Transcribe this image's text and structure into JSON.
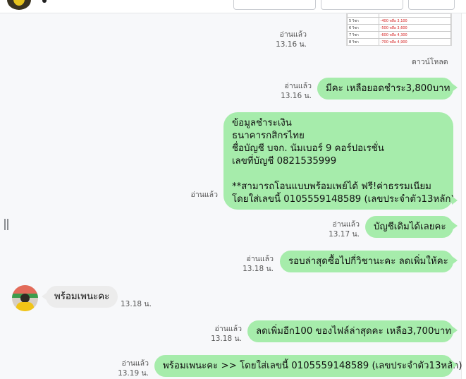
{
  "thumbnail": {
    "rows": [
      {
        "period": "5 วิชา",
        "price": "-400 หลือ 3,100"
      },
      {
        "period": "6 วิชา",
        "price": "-500 หลือ 3,600"
      },
      {
        "period": "7 วิชา",
        "price": "-600 หลือ 4,300"
      },
      {
        "period": "8 วิชา",
        "price": "-700 หลือ 4,900"
      }
    ]
  },
  "download_label": "ดาวน์โหลด",
  "messages": [
    {
      "read": "อ่านแล้ว",
      "time": "13.16 น."
    },
    {
      "read": "อ่านแล้ว",
      "time": "13.16 น.",
      "text": "มีคะ เหลือยอดชำระ3,800บาท"
    },
    {
      "read": "อ่านแล้ว",
      "lines": [
        "ข้อมูลชำระเงิน",
        "ธนาคารกสิกรไทย",
        "ชื่อบัญชี บจก. นัมเบอร์ 9 คอร์ปอเรชั่น",
        "เลขที่บัญชี 0821535999",
        "",
        "**สามารถโอนแบบพร้อมเพย์ได้ ฟรี!ค่าธรรมเนียม",
        "โดยใส่เลขนี้ 0105559148589 (เลขประจำตัว13หลัก)"
      ]
    },
    {
      "read": "อ่านแล้ว",
      "time": "13.17 น.",
      "text": "บัญชีเดิมได้เลยคะ"
    },
    {
      "read": "อ่านแล้ว",
      "time": "13.18 น.",
      "text": "รอบล่าสุดซื้อไปกี่วิชานะคะ ลดเพิ่มให้คะ"
    },
    {
      "time": "13.18 น.",
      "text": "พร้อมเพนะคะ"
    },
    {
      "read": "อ่านแล้ว",
      "time": "13.18 น.",
      "text": "ลดเพิ่มอีก100 ของไฟล์ล่าสุดคะ เหลือ3,700บาท"
    },
    {
      "read": "อ่านแล้ว",
      "time": "13.19 น.",
      "text": "พร้อมเพนะคะ >> โดยใส่เลขนี้ 0105559148589 (เลขประจำตัว13หลัก)"
    }
  ]
}
